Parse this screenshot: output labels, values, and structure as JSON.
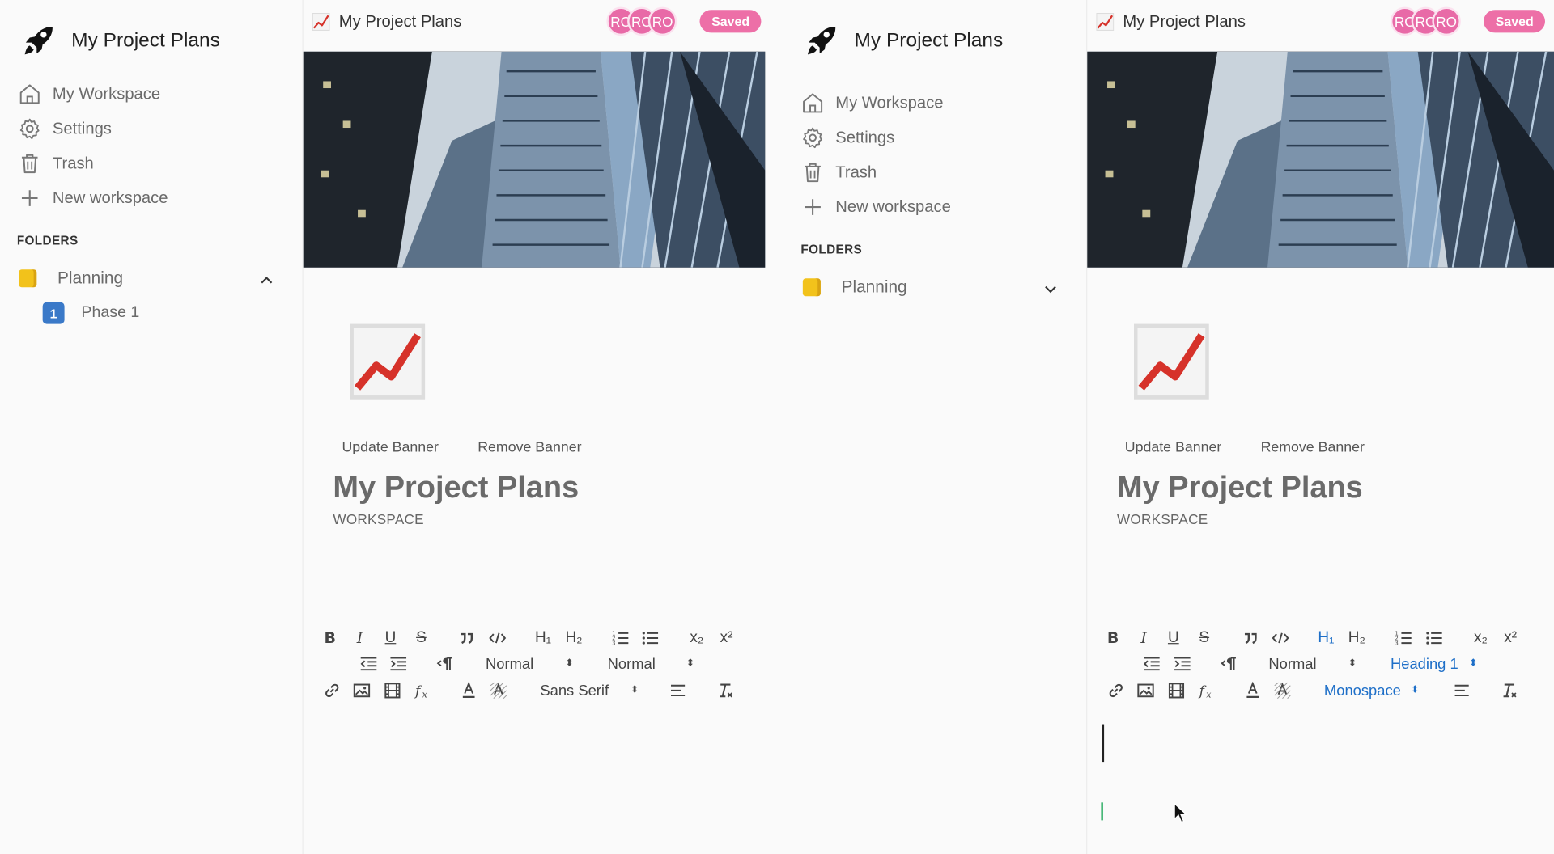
{
  "app": {
    "workspace_name": "My Project Plans",
    "saved_label": "Saved"
  },
  "sidebar": {
    "items": [
      {
        "label": "My Workspace",
        "icon": "home-icon"
      },
      {
        "label": "Settings",
        "icon": "gear-icon"
      },
      {
        "label": "Trash",
        "icon": "trash-icon"
      },
      {
        "label": "New workspace",
        "icon": "plus-icon"
      }
    ],
    "folders_label": "FOLDERS",
    "folder": {
      "label": "Planning",
      "icon": "folder-icon"
    },
    "subfolder": {
      "badge": "1",
      "label": "Phase 1"
    }
  },
  "document": {
    "header_title": "My Project Plans",
    "avatars": [
      "RO",
      "RO",
      "RO"
    ],
    "update_banner": "Update Banner",
    "remove_banner": "Remove Banner",
    "title": "My Project Plans",
    "subtitle": "WORKSPACE"
  },
  "toolbar": {
    "bold": "B",
    "italic": "I",
    "underline": "U",
    "strike": "S",
    "h1": "H₁",
    "h2": "H₂",
    "subscript": "x₂",
    "superscript": "x²",
    "left_panel": {
      "size": "Normal",
      "header": "Normal",
      "font": "Sans Serif"
    },
    "right_panel": {
      "size": "Normal",
      "header": "Heading 1",
      "font": "Monospace"
    }
  },
  "colors": {
    "accent_pink": "#ed6fa7",
    "active_blue": "#1e6fc8",
    "folder_yellow": "#f2c21b"
  }
}
